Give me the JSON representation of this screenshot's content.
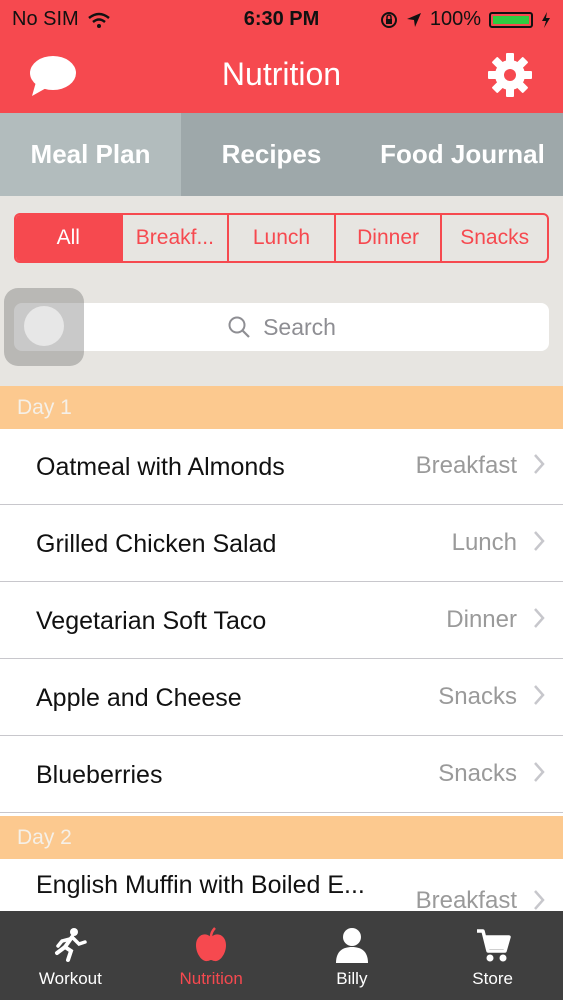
{
  "status_bar": {
    "carrier": "No SIM",
    "time": "6:30 PM",
    "battery_percent": "100%",
    "battery_level": 1.0
  },
  "header": {
    "title": "Nutrition",
    "left_icon": "chat-bubble-icon",
    "right_icon": "gear-icon"
  },
  "tabs": [
    {
      "label": "Meal Plan",
      "active": true
    },
    {
      "label": "Recipes",
      "active": false
    },
    {
      "label": "Food Journal",
      "active": false
    }
  ],
  "filters": [
    {
      "label": "All",
      "active": true
    },
    {
      "label": "Breakf..."
    },
    {
      "label": "Lunch"
    },
    {
      "label": "Dinner"
    },
    {
      "label": "Snacks"
    }
  ],
  "search": {
    "placeholder": "Search"
  },
  "days": [
    {
      "label": "Day 1",
      "items": [
        {
          "name": "Oatmeal with Almonds",
          "meal": "Breakfast"
        },
        {
          "name": "Grilled Chicken Salad",
          "meal": "Lunch"
        },
        {
          "name": "Vegetarian Soft Taco",
          "meal": "Dinner"
        },
        {
          "name": "Apple and Cheese",
          "meal": "Snacks"
        },
        {
          "name": "Blueberries",
          "meal": "Snacks"
        }
      ]
    },
    {
      "label": "Day 2",
      "items": [
        {
          "name": "English Muffin with Boiled E...",
          "meal": "Breakfast"
        }
      ]
    }
  ],
  "tab_bar": [
    {
      "label": "Workout",
      "icon": "running-person-icon",
      "active": false
    },
    {
      "label": "Nutrition",
      "icon": "apple-icon",
      "active": true
    },
    {
      "label": "Billy",
      "icon": "person-icon",
      "active": false
    },
    {
      "label": "Store",
      "icon": "cart-icon",
      "active": false
    }
  ],
  "colors": {
    "accent": "#f6494f",
    "day_header": "#fcc98f",
    "tab_bg": "#9ea8aa",
    "tabbar_bg": "#3f3f3f"
  }
}
